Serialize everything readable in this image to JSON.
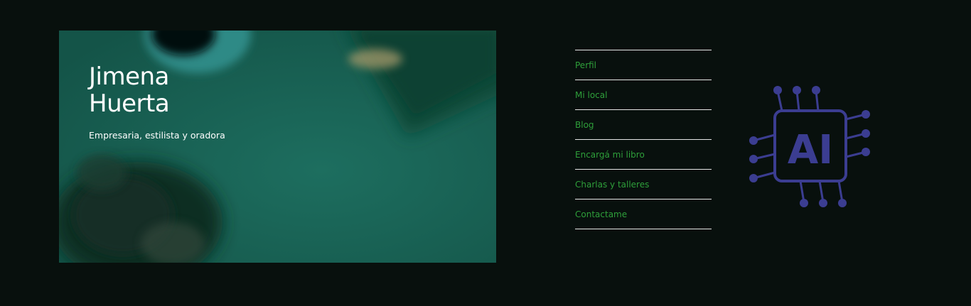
{
  "hero": {
    "title_line1": "Jimena",
    "title_line2": "Huerta",
    "subtitle": "Empresaria, estilista y oradora"
  },
  "nav": {
    "items": [
      {
        "label": "Perfil"
      },
      {
        "label": "Mi local"
      },
      {
        "label": "Blog"
      },
      {
        "label": "Encargá mi libro"
      },
      {
        "label": "Charlas y talleres"
      },
      {
        "label": "Contactame"
      }
    ]
  },
  "logo": {
    "text": "AI",
    "icon": "ai-chip-icon",
    "color": "#3b3d91"
  },
  "colors": {
    "background": "#08100d",
    "nav_link": "#2e9f3a",
    "divider": "#e6e6e6",
    "hero_teal": "#1a6a5a"
  }
}
